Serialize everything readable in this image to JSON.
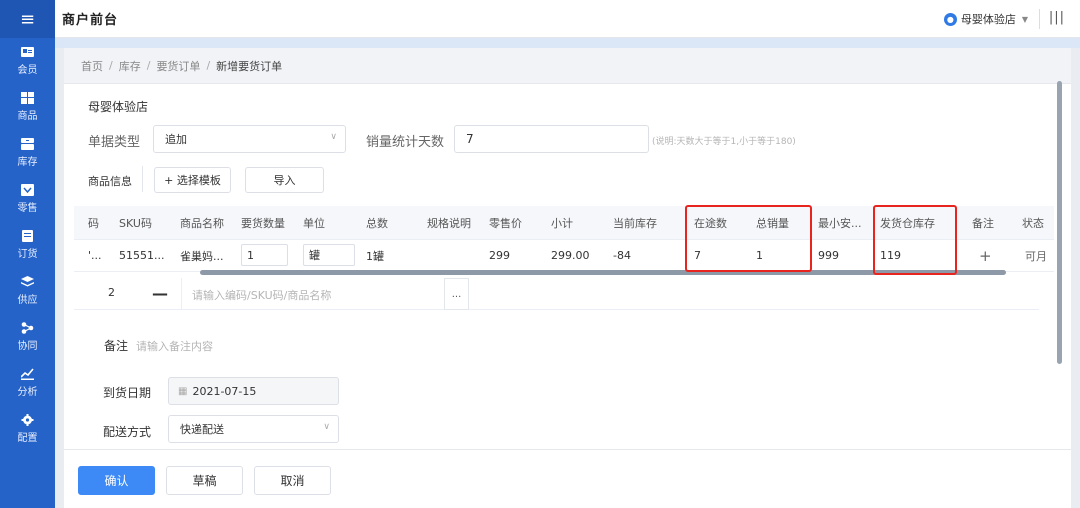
{
  "app": {
    "title": "商户前台",
    "store": "母婴体验店"
  },
  "sidebar": {
    "items": [
      {
        "label": "会员",
        "icon": "member-card-icon"
      },
      {
        "label": "商品",
        "icon": "goods-grid-icon"
      },
      {
        "label": "库存",
        "icon": "inventory-stack-icon"
      },
      {
        "label": "零售",
        "icon": "retail-cart-icon"
      },
      {
        "label": "订货",
        "icon": "order-doc-icon"
      },
      {
        "label": "供应",
        "icon": "supply-layers-icon"
      },
      {
        "label": "协同",
        "icon": "collab-share-icon"
      },
      {
        "label": "分析",
        "icon": "analysis-chart-icon"
      },
      {
        "label": "配置",
        "icon": "settings-gear-icon"
      }
    ]
  },
  "breadcrumb": [
    "首页",
    "库存",
    "要货订单",
    "新增要货订单"
  ],
  "form": {
    "store_name": "母婴体验店",
    "doc_type_label": "单据类型",
    "doc_type_value": "追加",
    "sales_days_label": "销量统计天数",
    "sales_days_value": "7",
    "sales_days_hint": "(说明:天数大于等于1,小于等于180)",
    "goods_info_label": "商品信息",
    "choose_template": "+ 选择模板",
    "import": "导入",
    "remark_label": "备注",
    "remark_placeholder": "请输入备注内容",
    "arrival_label": "到货日期",
    "arrival_value": "2021-07-15",
    "delivery_label": "配送方式",
    "delivery_value": "快递配送"
  },
  "table": {
    "headers": [
      "码",
      "SKU码",
      "商品名称",
      "要货数量",
      "单位",
      "总数",
      "规格说明",
      "零售价",
      "小计",
      "当前库存",
      "在途数",
      "总销量",
      "最小安...",
      "发货仓库存",
      "备注",
      "状态"
    ],
    "row": {
      "code": "'...",
      "sku": "51551...",
      "name": "雀巢妈...",
      "qty": "1",
      "unit": "罐",
      "total": "1罐",
      "spec": "",
      "price": "299",
      "subtotal": "299.00",
      "stock": "-84",
      "in_transit": "7",
      "total_sales": "1",
      "min_safe": "999",
      "warehouse_stock": "119",
      "remark": "+",
      "status": "可月"
    },
    "add_row": {
      "index": "2",
      "minus": "—",
      "placeholder": "请输入编码/SKU码/商品名称",
      "dots": "..."
    }
  },
  "footer": {
    "confirm": "确认",
    "draft": "草稿",
    "cancel": "取消"
  },
  "colors": {
    "sidebar": "#2563c9",
    "primary": "#3d8af7",
    "highlight": "#e8241f"
  }
}
